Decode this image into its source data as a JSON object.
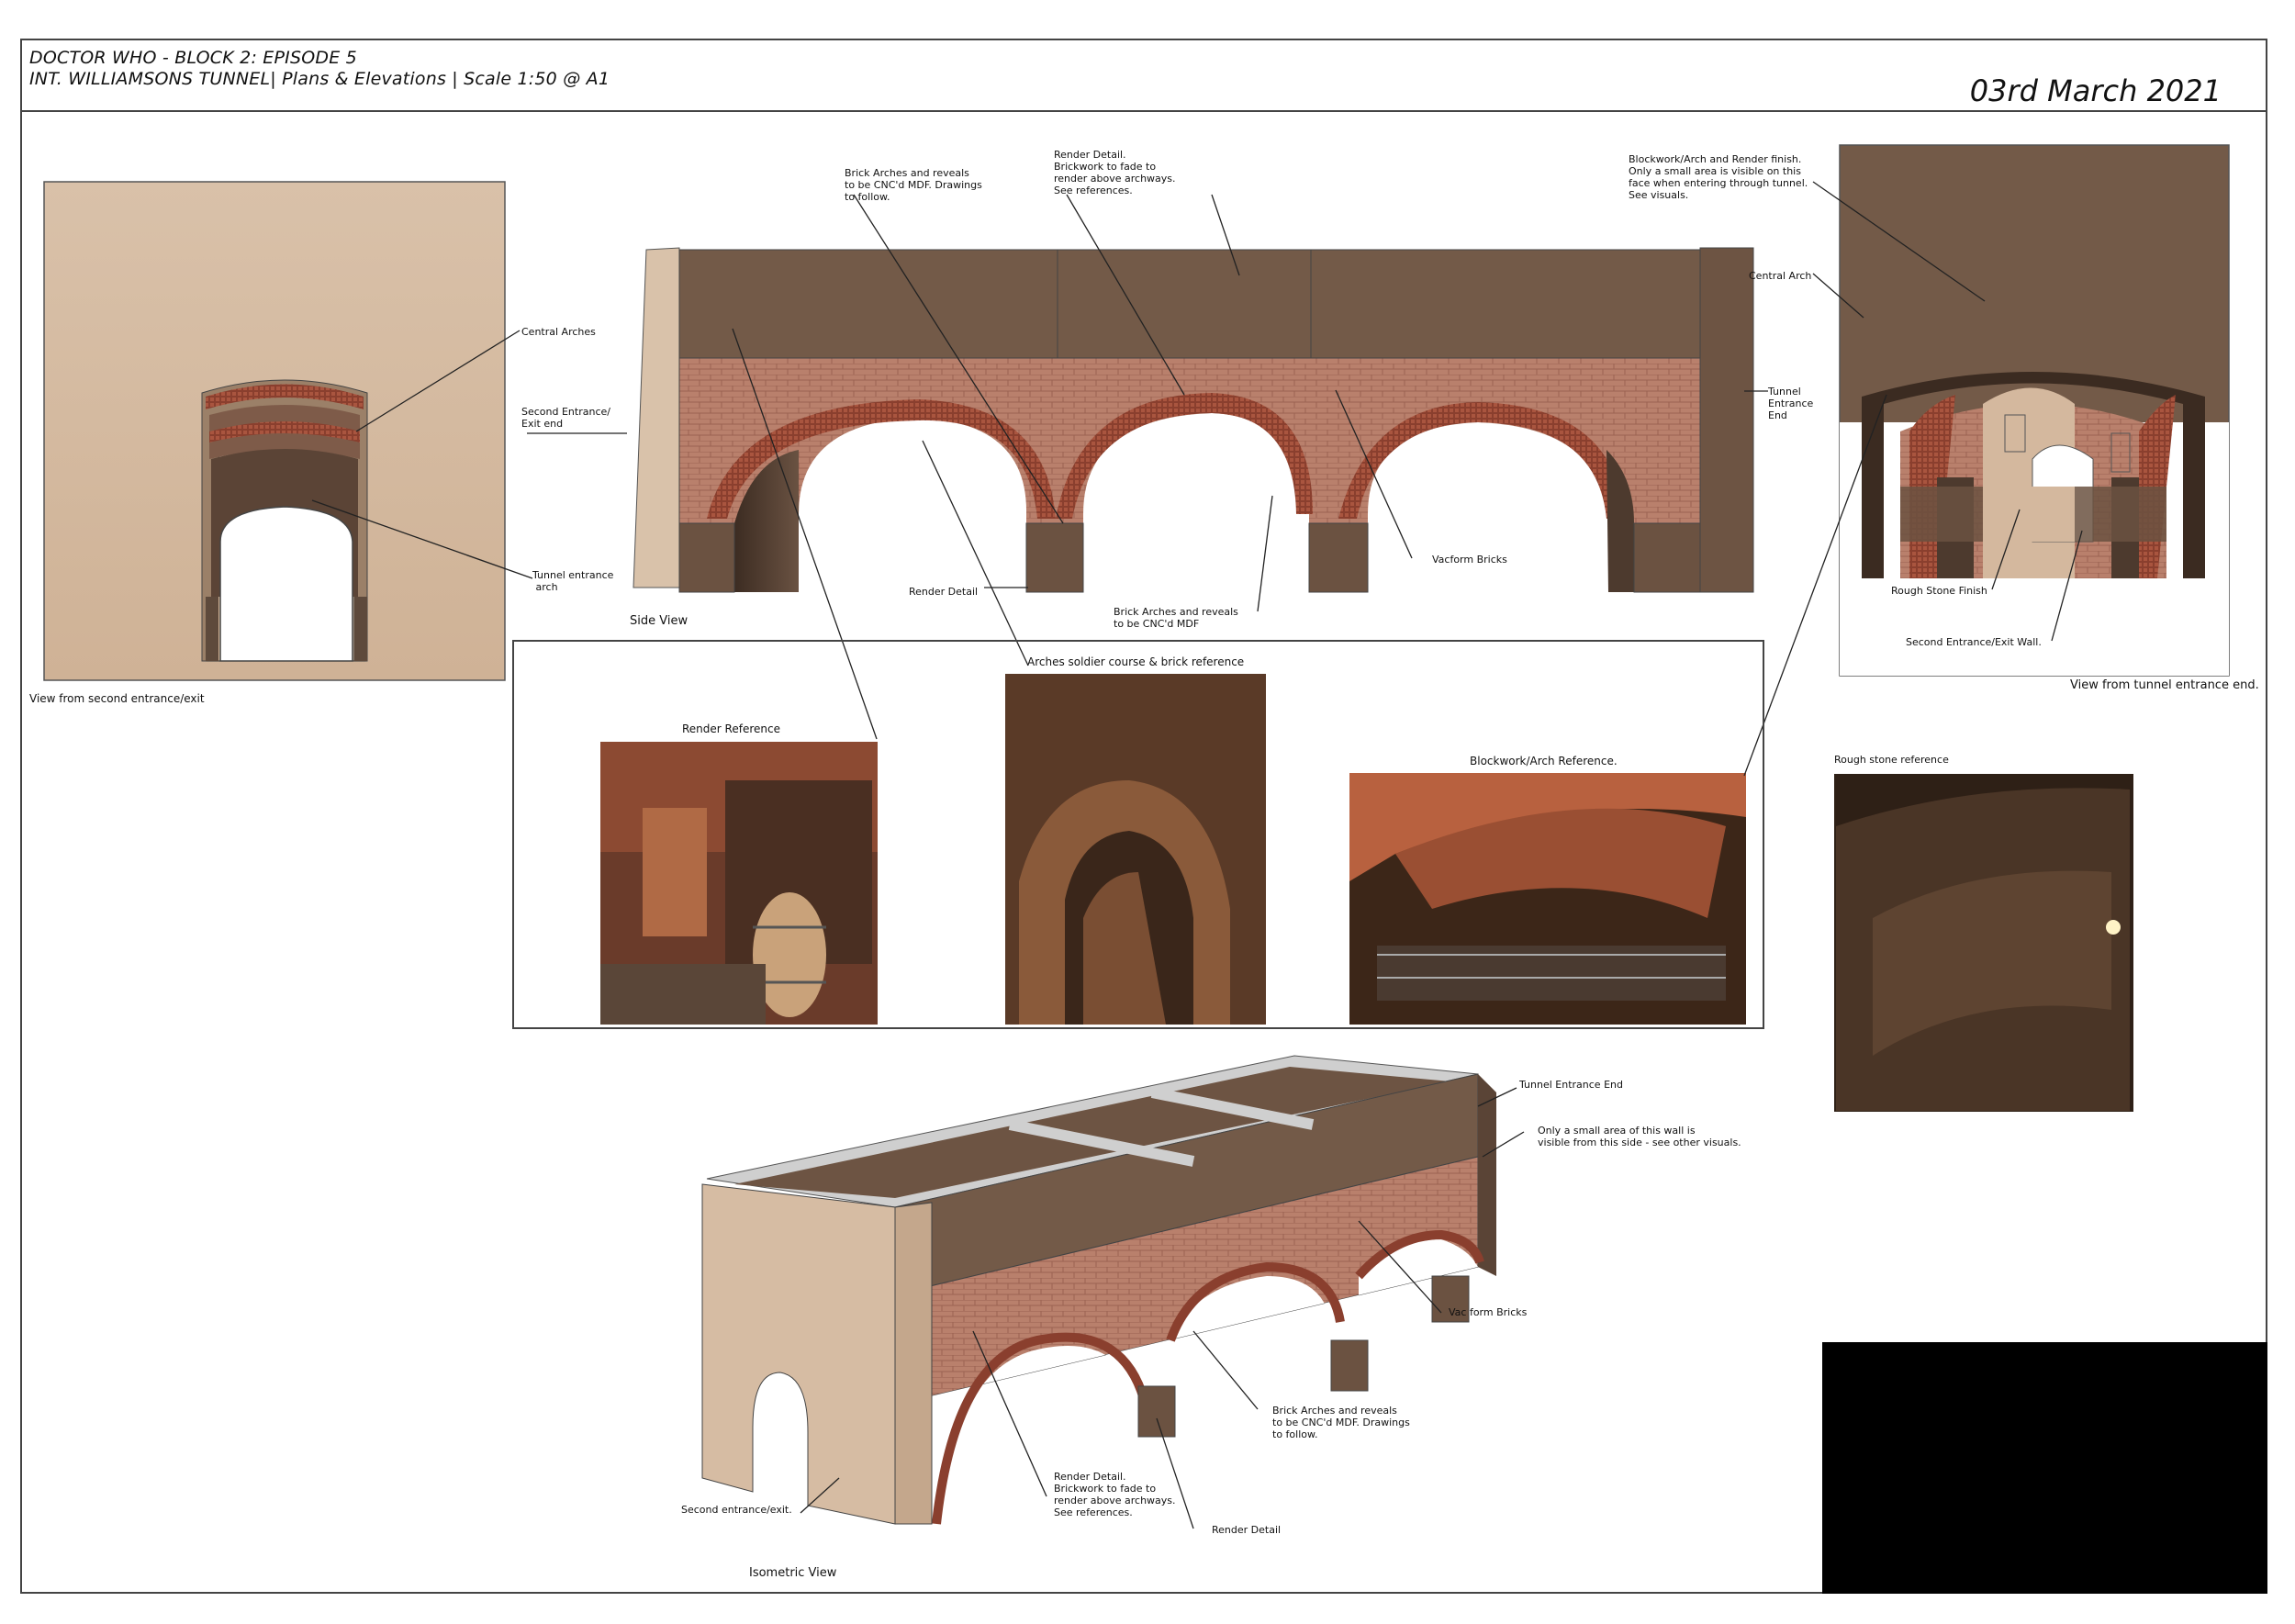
{
  "header": {
    "line1": "DOCTOR WHO - BLOCK 2: EPISODE 5",
    "line2": "INT. WILLIAMSONS TUNNEL| Plans & Elevations | Scale 1:50 @ A1",
    "date": "03rd March 2021"
  },
  "views": {
    "second_entrance": "View from second entrance/exit",
    "side": "Side View",
    "tunnel_end": "View from tunnel entrance end.",
    "isometric": "Isometric View"
  },
  "references": {
    "render": "Render Reference",
    "arches": "Arches soldier course & brick reference",
    "blockwork": "Blockwork/Arch Reference.",
    "rough_stone": "Rough stone reference"
  },
  "annotations": {
    "central_arches": "Central Arches",
    "second_entrance_exit_end": "Second Entrance/\nExit end",
    "tunnel_entrance_arch": "Tunnel entrance\n arch",
    "brick_arches_follow": "Brick Arches and reveals\nto be CNC'd MDF. Drawings\nto follow.",
    "render_detail_note": "Render Detail.\nBrickwork to fade to\nrender above archways.\nSee references.",
    "tunnel_entrance_end": "Tunnel\nEntrance\nEnd",
    "render_detail": "Render Detail",
    "brick_arches_mdf": "Brick Arches and reveals\nto be CNC'd MDF",
    "vacform_bricks": "Vacform Bricks",
    "blockwork_note": "Blockwork/Arch and Render finish.\nOnly a small area is visible on this\nface when entering through tunnel.\nSee visuals.",
    "central_arch": "Central Arch",
    "rough_stone_finish": "Rough Stone Finish",
    "second_entrance_wall": "Second Entrance/Exit Wall.",
    "tunnel_entrance_end_iso": "Tunnel Entrance End",
    "small_area_note": "Only a small area of this wall is\nvisible from this side - see other visuals.",
    "vac_form_bricks": "Vac form Bricks",
    "brick_arches_iso": "Brick Arches and reveals\nto be CNC'd MDF. Drawings\nto follow.",
    "render_detail_iso_note": "Render Detail.\nBrickwork to fade to\nrender above archways.\nSee references.",
    "render_detail_iso": "Render Detail",
    "second_entrance_exit": "Second entrance/exit."
  },
  "colors": {
    "render": "#d6bca3",
    "render_dark": "#c4a78c",
    "top_band": "#735a48",
    "brick": "#b77a68",
    "pier": "#6b5241",
    "soffit": "#4d3a2e",
    "arch_ring": "#8a3f2e"
  }
}
